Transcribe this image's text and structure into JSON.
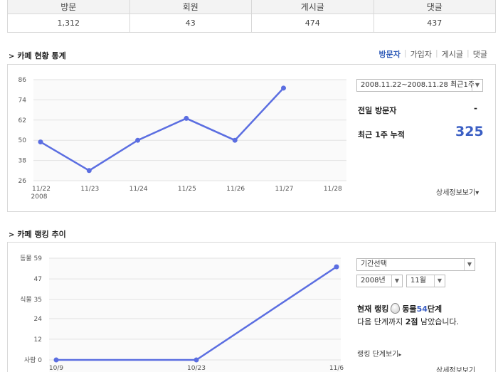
{
  "summary": {
    "headers": [
      "방문",
      "회원",
      "게시글",
      "댓글"
    ],
    "values": [
      "1,312",
      "43",
      "474",
      "437"
    ]
  },
  "stats_section": {
    "title": "카페 현황 통계",
    "tabs": [
      "방문자",
      "가입자",
      "게시글",
      "댓글"
    ],
    "active_tab": 0,
    "period_select": "2008.11.22~2008.11.28 최근1주",
    "yesterday_label": "전일 방문자",
    "yesterday_value": "-",
    "week_label": "최근 1주 누적",
    "week_value": "325",
    "detail_link": "상세정보보기▾"
  },
  "rank_section": {
    "title": "카페 랭킹 추이",
    "period_select": "기간선택",
    "year_select": "2008년",
    "month_select": "11월",
    "current_label": "현재 랭킹",
    "current_level_prefix": "동물",
    "current_level_num": "54",
    "current_level_suffix": "단계",
    "next_text_prefix": "다음 단계까지 ",
    "next_points": "2점",
    "next_text_suffix": " 남았습니다.",
    "level_link": "랭킹 단계보기",
    "detail_link": "상세정보보기"
  },
  "chart_data": [
    {
      "type": "line",
      "x": [
        "11/22",
        "11/23",
        "11/24",
        "11/25",
        "11/26",
        "11/27",
        "11/28"
      ],
      "x_sub": "2008",
      "values": [
        49,
        32,
        50,
        63,
        50,
        81,
        null
      ],
      "yticks": [
        26,
        38,
        50,
        62,
        74,
        86
      ],
      "ylim": [
        26,
        86
      ],
      "color": "#5b6ee1",
      "grid": true
    },
    {
      "type": "line",
      "x": [
        "10/9",
        "10/23",
        "11/6"
      ],
      "points": [
        [
          0,
          0
        ],
        [
          1,
          0
        ],
        [
          2,
          54
        ]
      ],
      "yticks": [
        0,
        12,
        24,
        35,
        47,
        59
      ],
      "ytick_labels": [
        "사람 0",
        "12",
        "24",
        "식물 35",
        "47",
        "동물 59"
      ],
      "ylim": [
        0,
        59
      ],
      "color": "#5b6ee1",
      "grid": true
    }
  ]
}
